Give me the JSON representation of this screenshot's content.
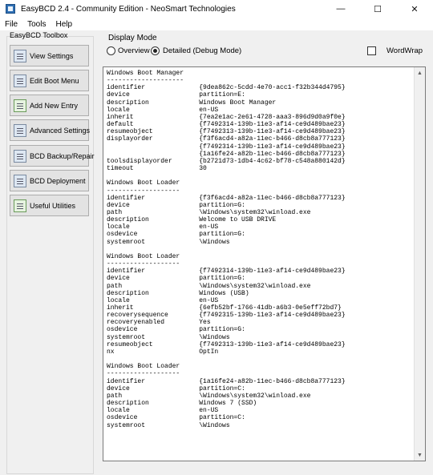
{
  "window": {
    "title": "EasyBCD 2.4 - Community Edition - NeoSmart Technologies",
    "minimize": "—",
    "maximize": "☐",
    "close": "✕"
  },
  "menu": {
    "items": [
      "File",
      "Tools",
      "Help"
    ]
  },
  "toolbox": {
    "title": "EasyBCD Toolbox",
    "buttons": [
      {
        "label": "View Settings",
        "icon": "view-settings-icon"
      },
      {
        "label": "Edit Boot Menu",
        "icon": "edit-boot-menu-icon"
      },
      {
        "label": "Add New Entry",
        "icon": "add-new-entry-icon"
      },
      {
        "label": "Advanced Settings",
        "icon": "advanced-settings-icon"
      },
      {
        "label": "BCD Backup/Repair",
        "icon": "bcd-backup-repair-icon"
      },
      {
        "label": "BCD Deployment",
        "icon": "bcd-deployment-icon"
      },
      {
        "label": "Useful Utilities",
        "icon": "useful-utilities-icon"
      }
    ]
  },
  "display_mode": {
    "title": "Display Mode",
    "overview_label": "Overview",
    "detailed_label": "Detailed (Debug Mode)",
    "selected": "detailed",
    "wordwrap_label": "WordWrap",
    "wordwrap_checked": false
  },
  "output": {
    "lines": [
      "Windows Boot Manager",
      "--------------------",
      "identifier              {9dea862c-5cdd-4e70-acc1-f32b344d4795}",
      "device                  partition=E:",
      "description             Windows Boot Manager",
      "locale                  en-US",
      "inherit                 {7ea2e1ac-2e61-4728-aaa3-896d9d0a9f0e}",
      "default                 {f7492314-139b-11e3-af14-ce9d489bae23}",
      "resumeobject            {f7492313-139b-11e3-af14-ce9d489bae23}",
      "displayorder            {f3f6acd4-a82a-11ec-b466-d8cb8a777123}",
      "                        {f7492314-139b-11e3-af14-ce9d489bae23}",
      "                        {1a16fe24-a82b-11ec-b466-d8cb8a777123}",
      "toolsdisplayorder       {b2721d73-1db4-4c62-bf78-c548a880142d}",
      "timeout                 30",
      "",
      "Windows Boot Loader",
      "-------------------",
      "identifier              {f3f6acd4-a82a-11ec-b466-d8cb8a777123}",
      "device                  partition=G:",
      "path                    \\Windows\\system32\\winload.exe",
      "description             Welcome to USB DRIVE",
      "locale                  en-US",
      "osdevice                partition=G:",
      "systemroot              \\Windows",
      "",
      "Windows Boot Loader",
      "-------------------",
      "identifier              {f7492314-139b-11e3-af14-ce9d489bae23}",
      "device                  partition=G:",
      "path                    \\Windows\\system32\\winload.exe",
      "description             Windows (USB)",
      "locale                  en-US",
      "inherit                 {6efb52bf-1766-41db-a6b3-0e5eff72bd7}",
      "recoverysequence        {f7492315-139b-11e3-af14-ce9d489bae23}",
      "recoveryenabled         Yes",
      "osdevice                partition=G:",
      "systemroot              \\Windows",
      "resumeobject            {f7492313-139b-11e3-af14-ce9d489bae23}",
      "nx                      OptIn",
      "",
      "Windows Boot Loader",
      "-------------------",
      "identifier              {1a16fe24-a82b-11ec-b466-d8cb8a777123}",
      "device                  partition=C:",
      "path                    \\Windows\\system32\\winload.exe",
      "description             Windows 7 (SSD)",
      "locale                  en-US",
      "osdevice                partition=C:",
      "systemroot              \\Windows"
    ]
  }
}
